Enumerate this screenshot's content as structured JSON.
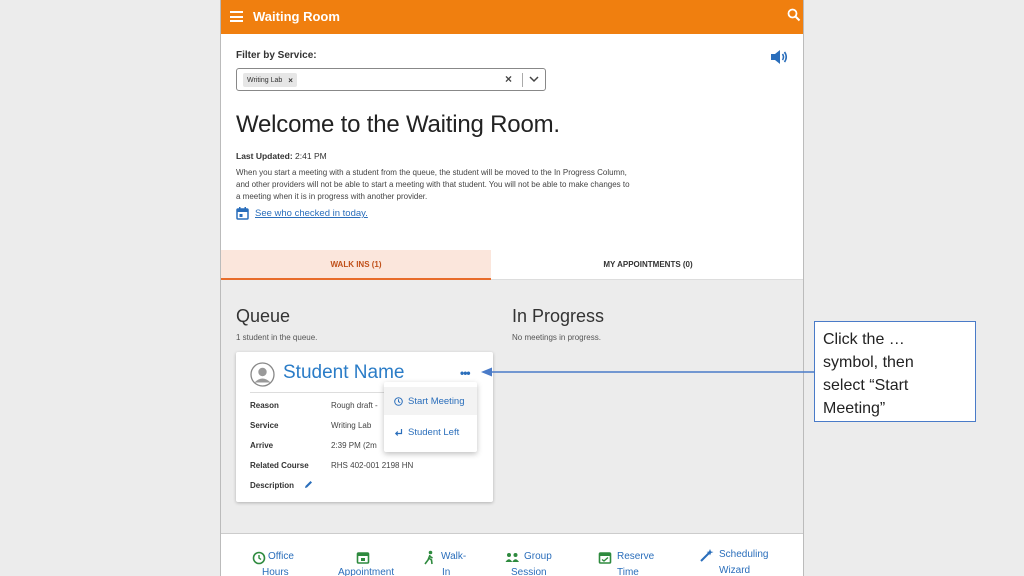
{
  "topbar": {
    "title": "Waiting Room"
  },
  "filter": {
    "label": "Filter by Service:",
    "chip": "Writing Lab",
    "chip_remove": "×",
    "clear": "×"
  },
  "welcome": {
    "heading": "Welcome to the Waiting Room.",
    "last_updated_label": "Last Updated:",
    "last_updated_value": "2:41 PM",
    "info_line1": "When you start a meeting with a student from the queue, the student will be moved to the In Progress Column,",
    "info_line2": "and other providers will not be able to start a meeting with that student. You will not be able to make changes to",
    "info_line3": "a meeting when it is in progress with another provider.",
    "checked_in_link": "See who checked in today."
  },
  "tabs": {
    "walk_ins": "WALK INS (1)",
    "my_appointments": "MY APPOINTMENTS (0)"
  },
  "queue": {
    "title": "Queue",
    "subtitle": "1 student in the queue."
  },
  "in_progress": {
    "title": "In Progress",
    "subtitle": "No meetings in progress."
  },
  "card": {
    "student_name": "Student Name",
    "menu_dots": "•••",
    "rows": [
      {
        "label": "Reason",
        "value": "Rough draft -"
      },
      {
        "label": "Service",
        "value": "Writing Lab"
      },
      {
        "label": "Arrive",
        "value": "2:39 PM (2m"
      },
      {
        "label": "Related Course",
        "value": "RHS 402-001 2198 HN"
      },
      {
        "label": "Description",
        "value": ""
      }
    ]
  },
  "popup_menu": {
    "start_meeting": "Start Meeting",
    "student_left": "Student Left"
  },
  "bottom_nav": [
    {
      "line1": "Office",
      "line2": "Hours"
    },
    {
      "line1": "",
      "line2": "Appointment"
    },
    {
      "line1": "Walk-",
      "line2": "In"
    },
    {
      "line1": "Group",
      "line2": "Session"
    },
    {
      "line1": "Reserve",
      "line2": "Time"
    },
    {
      "line1": "Scheduling",
      "line2": "Wizard"
    }
  ],
  "annotation": {
    "line1": "Click the …",
    "line2": "symbol, then",
    "line3": "select “Start",
    "line4": "Meeting”"
  },
  "colors": {
    "brand_orange": "#f07f0f",
    "link_blue": "#2a6ebb",
    "name_blue": "#2a7cc7",
    "nav_green": "#2e8a3e"
  }
}
